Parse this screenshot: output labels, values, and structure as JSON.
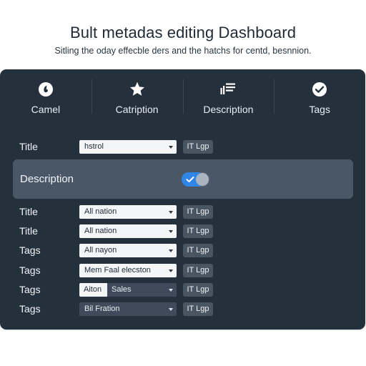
{
  "header": {
    "title": "Bult metadas editing Dashboard",
    "subtitle": "Sitling the oday effecble ders and the hatchs for centd, besnnion."
  },
  "tabs": [
    {
      "label": "Camel",
      "icon": "circle-pin-icon"
    },
    {
      "label": "Catription",
      "icon": "star-icon"
    },
    {
      "label": "Description",
      "icon": "bars-list-icon"
    },
    {
      "label": "Tags",
      "icon": "check-circle-icon"
    }
  ],
  "first_row": {
    "label": "Title",
    "select_value": "hstrol",
    "badge": "IT Lgp"
  },
  "description_row": {
    "label": "Description",
    "toggle_on": true,
    "accent_color": "#2f86e6"
  },
  "rows": [
    {
      "label": "Title",
      "select_value": "All nation",
      "badge": "IT Lgp"
    },
    {
      "label": "Title",
      "select_value": "All nation",
      "badge": "IT Lgp"
    },
    {
      "label": "Tags",
      "select_value": "All nayon",
      "badge": "IT Lgp"
    },
    {
      "label": "Tags",
      "select_value": "Mem Faal elecston",
      "badge": "IT Lgp"
    },
    {
      "label": "Tags",
      "select_value_left": "Aiton",
      "select_value_right": "Sales",
      "badge": "IT Lgp"
    },
    {
      "label": "Tags",
      "select_value": "Bil Fration",
      "badge": "IT Lgp"
    }
  ]
}
